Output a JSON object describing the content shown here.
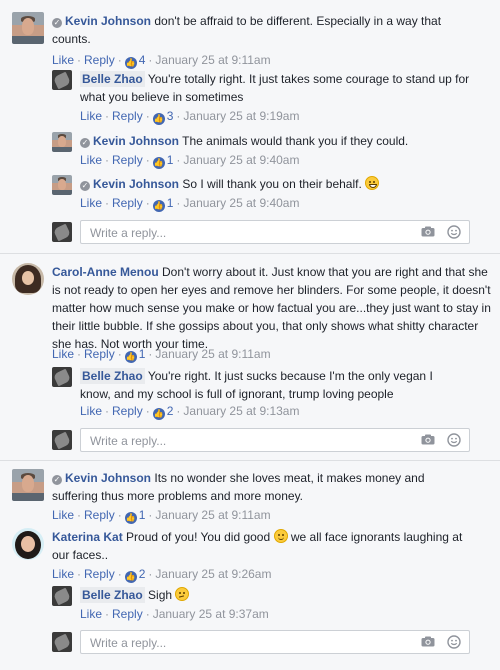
{
  "common": {
    "like": "Like",
    "reply": "Reply",
    "reply_placeholder": "Write a reply..."
  },
  "threads": [
    {
      "comment": {
        "author": "Kevin Johnson",
        "text": "don't be affraid to be different. Especially in a way that counts.",
        "likes": "4",
        "time": "January 25 at 9:11am"
      },
      "replies": [
        {
          "author": "Belle Zhao",
          "text": "You're totally right. It just takes some courage to stand up for what you believe in sometimes",
          "likes": "3",
          "time": "January 25 at 9:19am"
        },
        {
          "author": "Kevin Johnson",
          "text": "The animals would thank you if they could.",
          "likes": "1",
          "time": "January 25 at 9:40am"
        },
        {
          "author": "Kevin Johnson",
          "text": "So I will thank you on their behalf.",
          "emoji": "grinning-face",
          "likes": "1",
          "time": "January 25 at 9:40am"
        }
      ]
    },
    {
      "comment": {
        "author": "Carol-Anne Menou",
        "text": "Don't worry about it. Just know that you are right and that she is not ready to open her eyes and remove her blinders. For some people, it doesn't matter how much sense you make or how factual you are...they just want to stay in their little bubble. If she gossips about you, that only shows what shitty character she has. Not worth your time.",
        "likes": "1",
        "time": "January 25 at 9:11am"
      },
      "replies": [
        {
          "author": "Belle Zhao",
          "text": "You're right. It just sucks because I'm the only vegan I know, and my school is full of ignorant, trump loving people",
          "likes": "2",
          "time": "January 25 at 9:13am"
        }
      ]
    },
    {
      "comment": {
        "author": "Kevin Johnson",
        "text": "Its no wonder she loves meat, it makes money and suffering thus more problems and more money.",
        "likes": "1",
        "time": "January 25 at 9:11am"
      },
      "replies": []
    },
    {
      "comment": {
        "author": "Katerina Kat",
        "text": "Proud of you! You did good",
        "text_after": "we all face ignorants laughing at our faces..",
        "emoji": "smiling-face",
        "likes": "2",
        "time": "January 25 at 9:26am"
      },
      "replies": [
        {
          "author": "Belle Zhao",
          "text": "Sigh",
          "emoji": "confused-face",
          "time": "January 25 at 9:37am"
        }
      ]
    }
  ]
}
